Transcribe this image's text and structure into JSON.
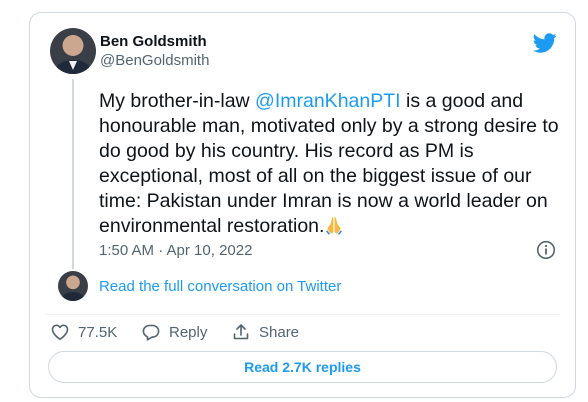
{
  "author": {
    "name": "Ben Goldsmith",
    "handle": "@BenGoldsmith"
  },
  "tweet": {
    "text_before": "My brother-in-law ",
    "mention": "@ImranKhanPTI",
    "text_after": " is a good and honourable man, motivated only by a strong desire to do good by his country. His record as PM is exceptional, most of all on the biggest issue of our time: Pakistan under Imran is now a world leader on environmental restoration.",
    "emoji_icon": "folded-hands-icon",
    "timestamp": "1:50 AM · Apr 10, 2022"
  },
  "conversation_link": "Read the full conversation on Twitter",
  "actions": {
    "likes": "77.5K",
    "reply": "Reply",
    "share": "Share"
  },
  "replies_button": "Read 2.7K replies",
  "colors": {
    "accent": "#1d9bf0",
    "text": "#0f1419",
    "secondary": "#536471",
    "border": "#cfd9de"
  }
}
